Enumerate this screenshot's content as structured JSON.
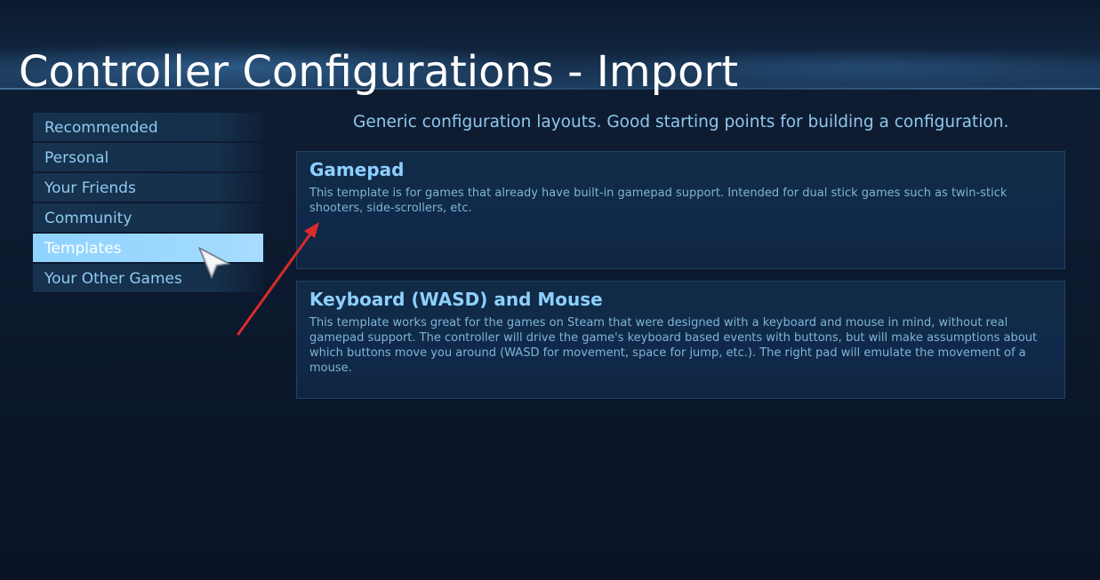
{
  "header": {
    "title": "Controller Configurations - Import"
  },
  "sidebar": {
    "items": [
      {
        "label": "Recommended",
        "selected": false
      },
      {
        "label": "Personal",
        "selected": false
      },
      {
        "label": "Your Friends",
        "selected": false
      },
      {
        "label": "Community",
        "selected": false
      },
      {
        "label": "Templates",
        "selected": true
      },
      {
        "label": "Your Other Games",
        "selected": false
      }
    ]
  },
  "main": {
    "description": "Generic configuration layouts. Good starting points for building a configuration.",
    "templates": [
      {
        "title": "Gamepad",
        "description": "This template is for games that already have built-in gamepad support.  Intended for dual stick games such as twin-stick shooters, side-scrollers, etc."
      },
      {
        "title": "Keyboard (WASD) and Mouse",
        "description": "This template works great for the games on Steam that were designed with a keyboard and mouse in mind, without real gamepad support. The controller will drive the game's keyboard based events with buttons, but will make assumptions about which buttons move you around (WASD for movement, space for jump, etc.). The right pad will emulate the movement of a mouse."
      }
    ]
  },
  "colors": {
    "accent": "#8ed0ff",
    "selected_bg": "#9ad8ff",
    "annotation_arrow": "#d92b2b"
  },
  "icons": {
    "cursor": "mouse-pointer-icon",
    "annotation": "red-arrow-icon"
  }
}
